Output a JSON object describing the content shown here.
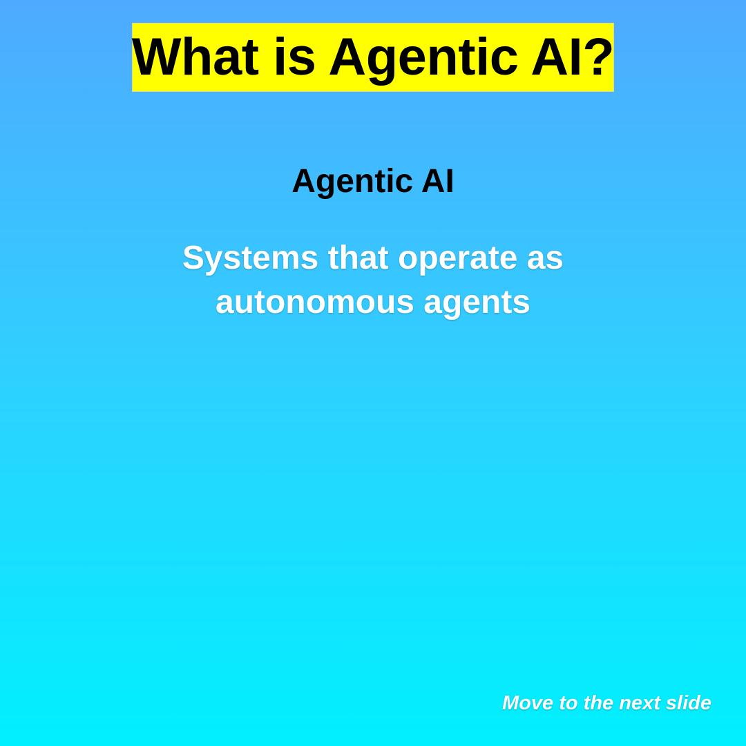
{
  "slide": {
    "title": "What is Agentic AI?",
    "term": "Agentic AI",
    "definition_line1": "Systems that operate as",
    "definition_line2": "autonomous agents",
    "next_hint": "Move to the next slide"
  },
  "colors": {
    "title_highlight": "#ffff00",
    "background_top": "#4faaff",
    "background_bottom": "#00f0ff",
    "definition_text": "#ffffff",
    "term_text": "#000000"
  }
}
